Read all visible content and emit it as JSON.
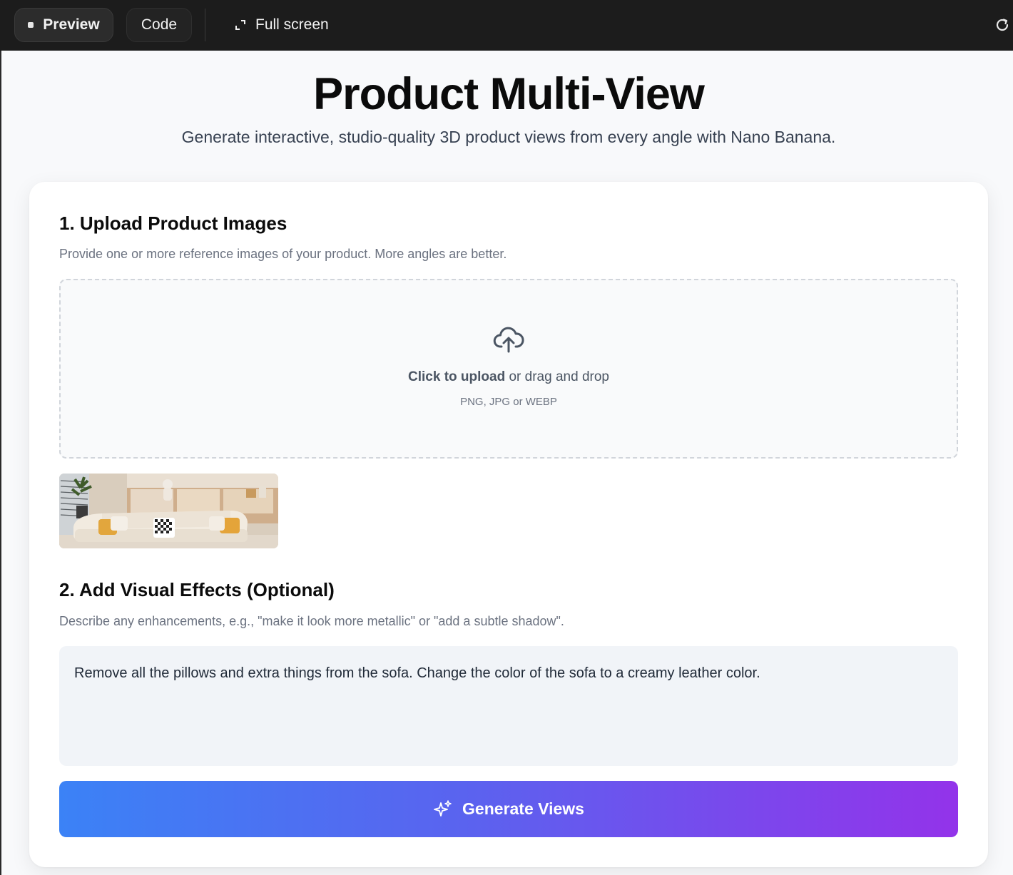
{
  "toolbar": {
    "preview_label": "Preview",
    "code_label": "Code",
    "fullscreen_label": "Full screen",
    "icons": [
      "square-dot-icon",
      "expand-icon",
      "refresh-icon"
    ]
  },
  "header": {
    "title": "Product Multi-View",
    "subtitle": "Generate interactive, studio-quality 3D product views from every angle with Nano Banana."
  },
  "upload": {
    "heading": "1. Upload Product Images",
    "description": "Provide one or more reference images of your product. More angles are better.",
    "drop_bold": "Click to upload",
    "drop_rest": " or drag and drop",
    "formats": "PNG, JPG or WEBP",
    "icon": "cloud-upload-icon"
  },
  "effects": {
    "heading": "2. Add Visual Effects (Optional)",
    "description": "Describe any enhancements, e.g., \"make it look more metallic\" or \"add a subtle shadow\".",
    "value": "Remove all the pillows and extra things from the sofa. Change the color of the sofa to a creamy leather color."
  },
  "generate": {
    "label": "Generate Views",
    "icon": "sparkles-icon"
  },
  "colors": {
    "accent_start": "#3b82f6",
    "accent_end": "#9333ea",
    "topbar": "#1c1c1c"
  }
}
